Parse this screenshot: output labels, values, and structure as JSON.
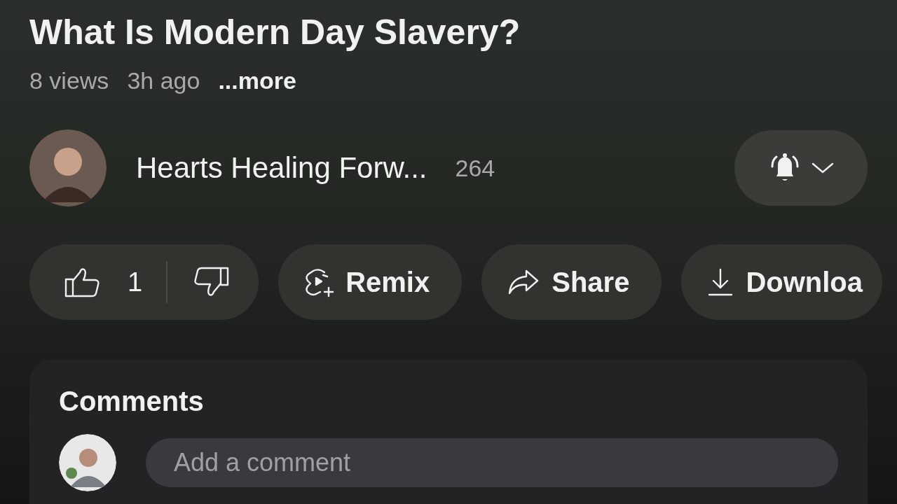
{
  "video": {
    "title": "What Is Modern Day Slavery?",
    "views": "8 views",
    "age": "3h ago",
    "more": "...more"
  },
  "channel": {
    "name": "Hearts Healing Forw...",
    "subscribers": "264",
    "notifications": true
  },
  "actions": [
    {
      "kind": "like",
      "count": "1"
    },
    {
      "kind": "remix",
      "label": "Remix"
    },
    {
      "kind": "share",
      "label": "Share"
    },
    {
      "kind": "download",
      "label": "Downloa"
    }
  ],
  "comments": {
    "heading": "Comments",
    "placeholder": "Add a comment"
  }
}
